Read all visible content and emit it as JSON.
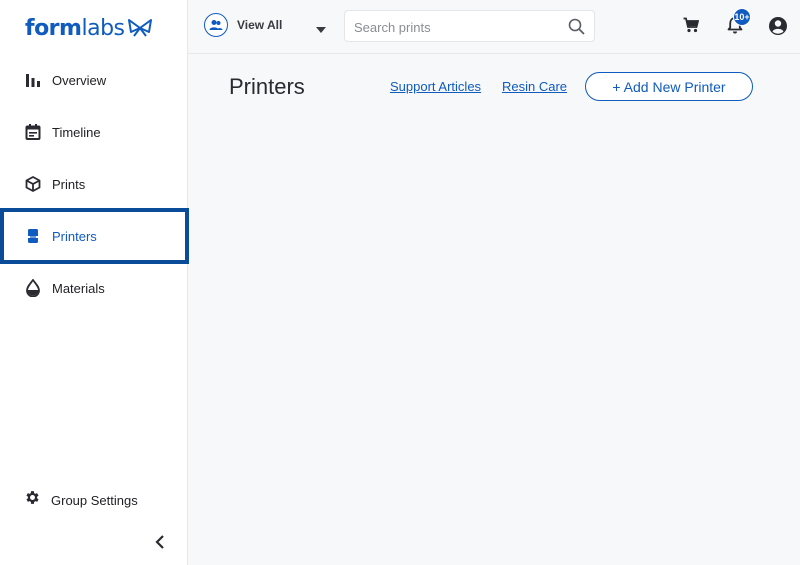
{
  "brand": {
    "logo_bold": "form",
    "logo_light": "labs"
  },
  "sidebar": {
    "items": [
      {
        "label": "Overview",
        "icon": "bar-chart-icon"
      },
      {
        "label": "Timeline",
        "icon": "calendar-icon"
      },
      {
        "label": "Prints",
        "icon": "cube-icon"
      },
      {
        "label": "Printers",
        "icon": "printer-icon",
        "active": true
      },
      {
        "label": "Materials",
        "icon": "droplet-icon"
      }
    ],
    "group_settings": {
      "label": "Group Settings",
      "icon": "gear-icon"
    }
  },
  "header": {
    "view_label": "View All",
    "search": {
      "placeholder": "Search prints",
      "value": ""
    },
    "notifications_badge": "10+"
  },
  "main": {
    "title": "Printers",
    "links": [
      "Support Articles",
      "Resin Care"
    ],
    "add_button": "+ Add New Printer"
  },
  "colors": {
    "accent": "#0f5bbf",
    "active_border": "#0a4c9a"
  }
}
